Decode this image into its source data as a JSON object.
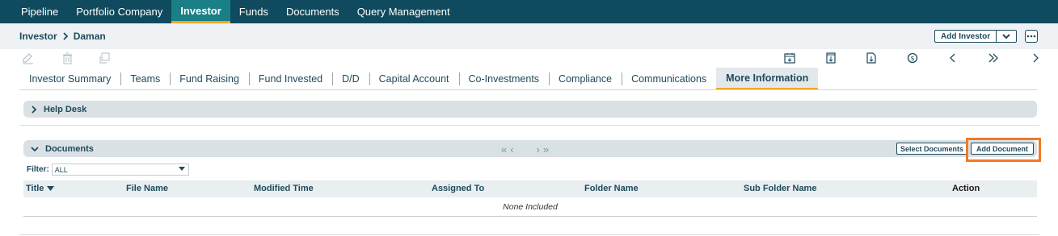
{
  "nav": {
    "items": [
      {
        "label": "Pipeline",
        "active": false
      },
      {
        "label": "Portfolio Company",
        "active": false
      },
      {
        "label": "Investor",
        "active": true
      },
      {
        "label": "Funds",
        "active": false
      },
      {
        "label": "Documents",
        "active": false
      },
      {
        "label": "Query Management",
        "active": false
      }
    ]
  },
  "breadcrumb": {
    "parent": "Investor",
    "current": "Daman"
  },
  "header": {
    "add_investor_label": "Add Investor"
  },
  "toolbar": {
    "left_icons": [
      "edit-icon",
      "delete-icon",
      "copy-icon"
    ],
    "right_icons": [
      "calendar-icon",
      "bookmark-icon",
      "download-document-icon",
      "refresh-currency-icon",
      "previous-icon",
      "fast-forward-icon",
      "next-icon"
    ]
  },
  "tabs": [
    {
      "label": "Investor Summary",
      "active": false
    },
    {
      "label": "Teams",
      "active": false
    },
    {
      "label": "Fund Raising",
      "active": false
    },
    {
      "label": "Fund Invested",
      "active": false
    },
    {
      "label": "D/D",
      "active": false
    },
    {
      "label": "Capital Account",
      "active": false
    },
    {
      "label": "Co-Investments",
      "active": false
    },
    {
      "label": "Compliance",
      "active": false
    },
    {
      "label": "Communications",
      "active": false
    },
    {
      "label": "More Information",
      "active": true
    }
  ],
  "help_desk": {
    "title": "Help Desk"
  },
  "documents": {
    "title": "Documents",
    "pager": {
      "first": "«",
      "prev": "‹",
      "next": "›",
      "last": "»"
    },
    "select_label": "Select Documents",
    "add_label": "Add Document",
    "filter_label": "Filter:",
    "filter_value": "ALL",
    "columns": [
      "Title",
      "File Name",
      "Modified Time",
      "Assigned To",
      "Folder Name",
      "Sub Folder Name",
      "Action"
    ],
    "empty_text": "None Included"
  },
  "colors": {
    "nav_bg": "#0f4a5e",
    "active_tab": "#1b7f86",
    "accent": "#f5a623",
    "highlight": "#f07a24"
  }
}
